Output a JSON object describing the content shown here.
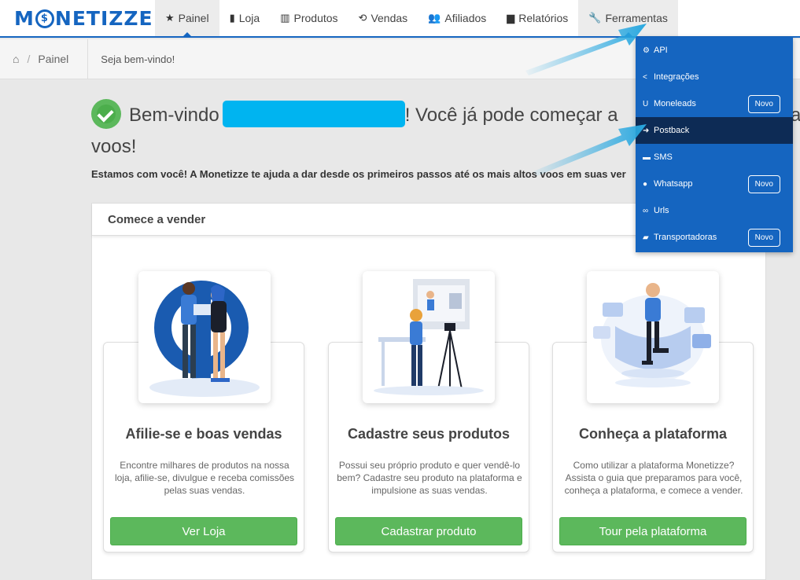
{
  "logo": {
    "pre": "M",
    "coin": "$",
    "post": "NETIZZE"
  },
  "nav": [
    {
      "icon": "★",
      "label": "Painel"
    },
    {
      "icon": "▮",
      "label": "Loja"
    },
    {
      "icon": "▥",
      "label": "Produtos"
    },
    {
      "icon": "⟲",
      "label": "Vendas"
    },
    {
      "icon": "👥",
      "label": "Afiliados"
    },
    {
      "icon": "▆",
      "label": "Relatórios"
    },
    {
      "icon": "🔧",
      "label": "Ferramentas"
    }
  ],
  "breadcrumb": {
    "home_icon": "home-icon",
    "separator": "/",
    "current": "Painel",
    "welcome": "Seja bem-vindo!"
  },
  "welcome": {
    "pre": "Bem-vindo",
    "post": "! Você já pode começar a",
    "tail": "a",
    "line2": "voos!"
  },
  "subtitle": "Estamos com você! A Monetizze te ajuda a dar desde os primeiros passos até os mais altos voos em suas ver",
  "panel": {
    "title": "Comece a vender"
  },
  "cards": [
    {
      "title": "Afilie-se e boas vendas",
      "desc": "Encontre milhares de produtos na nossa loja, afilie-se, divulgue e receba comissões pelas suas vendas.",
      "button": "Ver Loja"
    },
    {
      "title": "Cadastre seus produtos",
      "desc": "Possui seu próprio produto e quer vendê-lo bem? Cadastre seu produto na plataforma e impulsione as suas vendas.",
      "button": "Cadastrar produto"
    },
    {
      "title": "Conheça a plataforma",
      "desc": "Como utilizar a plataforma Monetizze? Assista o guia que preparamos para você, conheça a plataforma, e comece a vender.",
      "button": "Tour pela plataforma"
    }
  ],
  "dropdown": [
    {
      "icon": "⚙",
      "label": "API",
      "badge": ""
    },
    {
      "icon": "<",
      "label": "Integrações",
      "badge": ""
    },
    {
      "icon": "U",
      "label": "Moneleads",
      "badge": "Novo"
    },
    {
      "icon": "➜",
      "label": "Postback",
      "badge": ""
    },
    {
      "icon": "▬",
      "label": "SMS",
      "badge": ""
    },
    {
      "icon": "●",
      "label": "Whatsapp",
      "badge": "Novo"
    },
    {
      "icon": "∞",
      "label": "Urls",
      "badge": ""
    },
    {
      "icon": "▰",
      "label": "Transportadoras",
      "badge": "Novo"
    }
  ],
  "colors": {
    "brand": "#1565c0",
    "success": "#5cb85c",
    "highlight": "#0d2b55",
    "redaction": "#00b4f0",
    "arrow": "#29a8e0"
  }
}
